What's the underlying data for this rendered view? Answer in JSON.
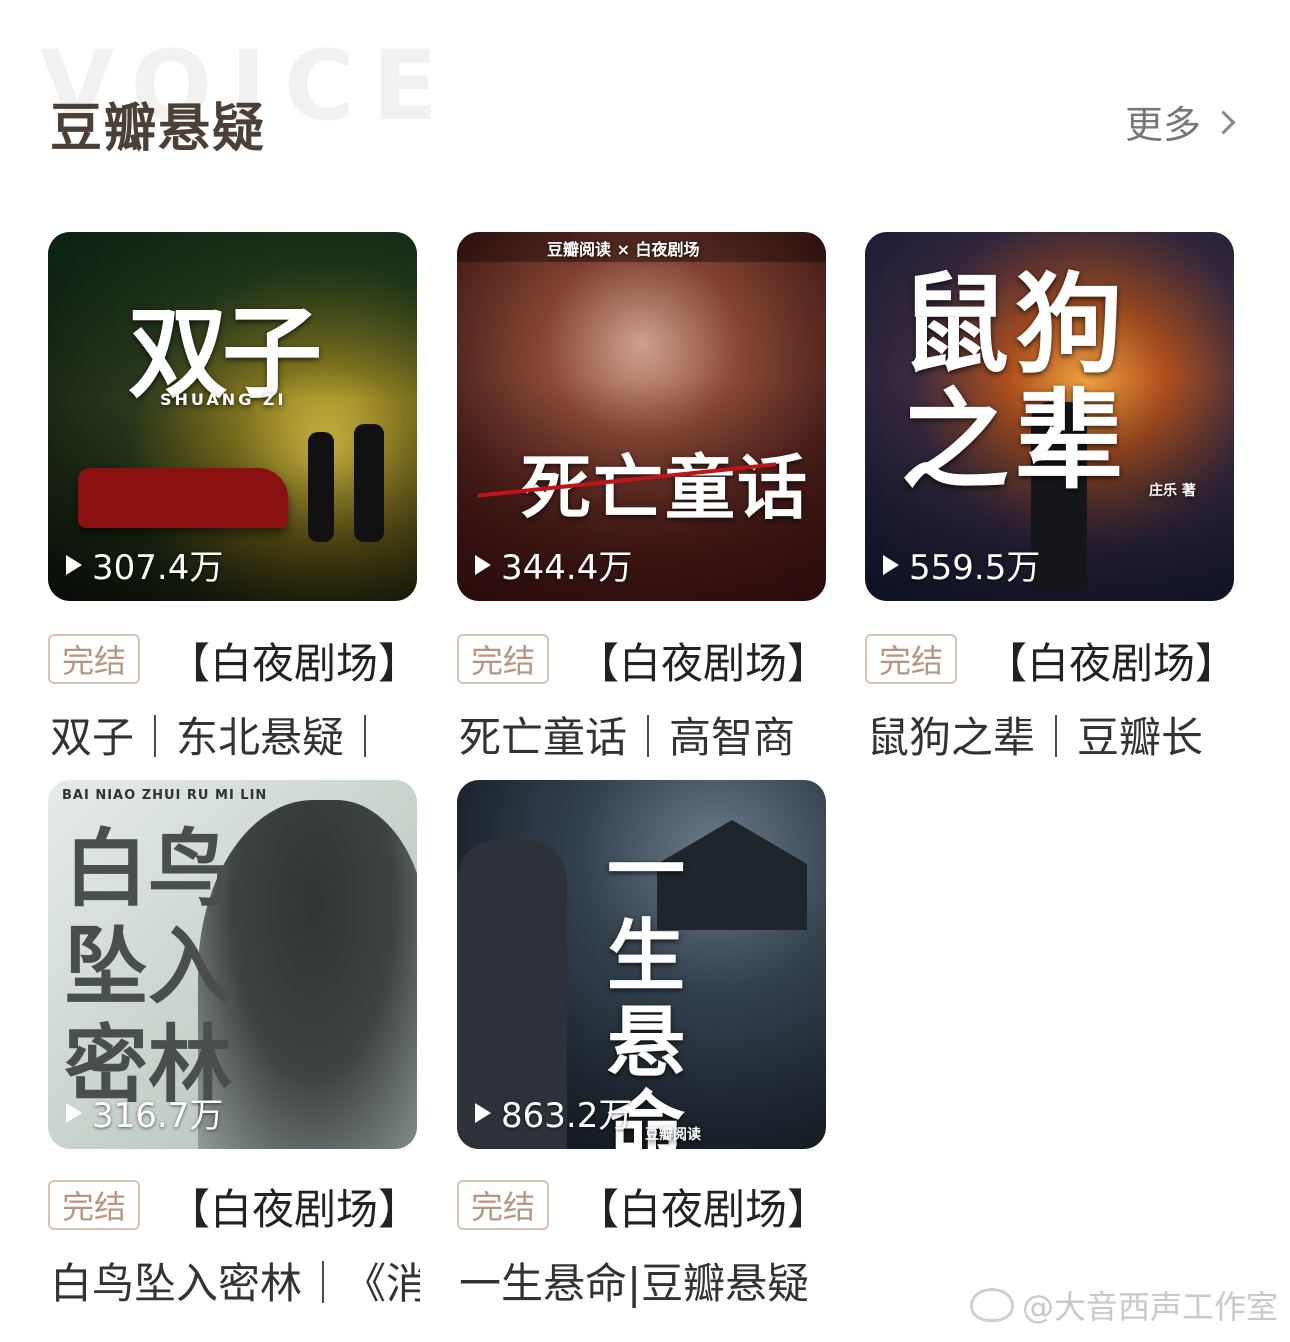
{
  "header": {
    "watermark": "VOICE",
    "title": "豆瓣悬疑",
    "more_label": "更多"
  },
  "items": [
    {
      "badge": "完结",
      "series": "【白夜剧场】",
      "desc": "双子｜东北悬疑｜",
      "plays": "307.4万",
      "cover_title": "双子",
      "cover_sub": "SHUANG ZI"
    },
    {
      "badge": "完结",
      "series": "【白夜剧场】",
      "desc": "死亡童话｜高智商",
      "plays": "344.4万",
      "cover_title": "死亡童话",
      "cover_sub": "豆瓣阅读 × 白夜剧场"
    },
    {
      "badge": "完结",
      "series": "【白夜剧场】",
      "desc": "鼠狗之辈｜豆瓣长",
      "plays": "559.5万",
      "cover_title": "鼠狗之辈",
      "cover_sub": "庄乐 著"
    },
    {
      "badge": "完结",
      "series": "【白夜剧场】",
      "desc": "白鸟坠入密林｜《消",
      "plays": "316.7万",
      "cover_title": "白鸟坠入密林",
      "cover_sub": "BAI NIAO ZHUI RU MI LIN"
    },
    {
      "badge": "完结",
      "series": "【白夜剧场】",
      "desc": "一生悬命|豆瓣悬疑",
      "plays": "863.2万",
      "cover_title": "一生悬命",
      "cover_sub": "豆瓣阅读"
    }
  ],
  "footer": {
    "weibo_watermark": "@大音西声工作室"
  },
  "colors": {
    "title": "#4b3f36",
    "badge_border": "#d9c3b5",
    "badge_text": "#b89580"
  }
}
